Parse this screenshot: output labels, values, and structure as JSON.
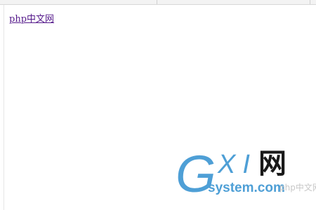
{
  "page": {
    "link_text": "php中文网"
  },
  "watermark": {
    "brand_g": "G",
    "brand_xi": "XI",
    "brand_wang": "网",
    "brand_domain": "system.com",
    "overlay_text": "php中文网",
    "colors": {
      "brand_blue": "#4e9fd6",
      "brand_dark": "#1a1a1a"
    }
  },
  "colors": {
    "link_visited": "#551a8b",
    "background": "#ffffff"
  }
}
